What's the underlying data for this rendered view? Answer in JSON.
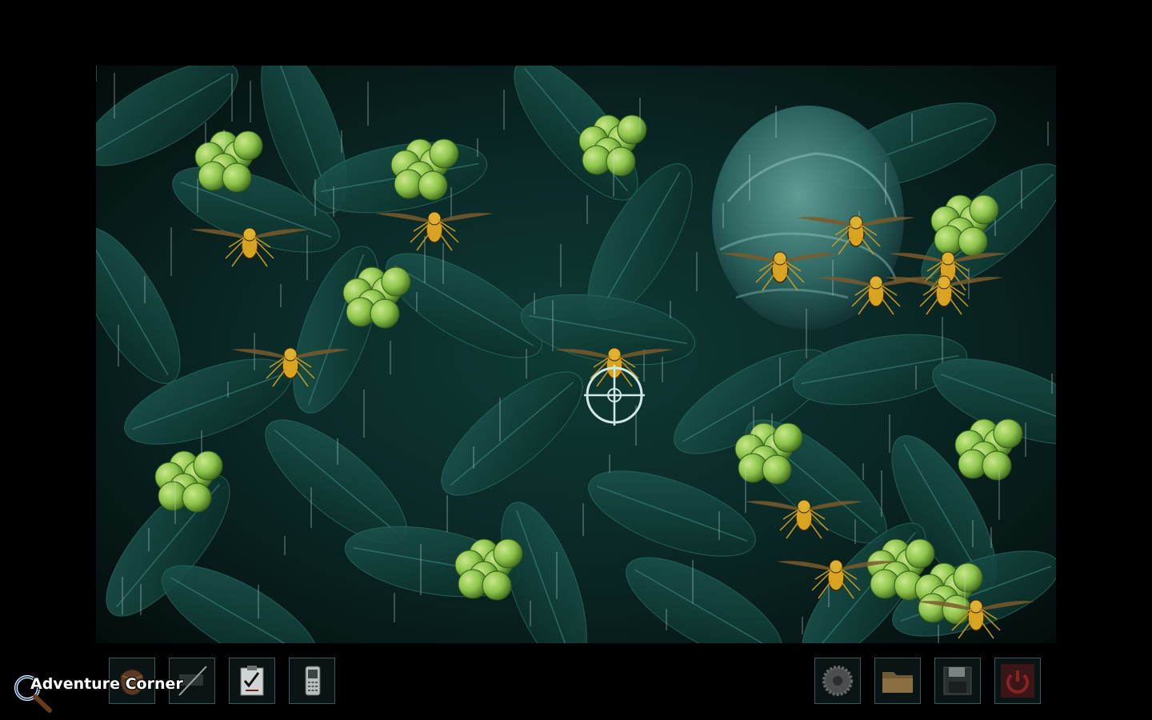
{
  "game": {
    "scene_name": "loquat-tree-with-wasps",
    "weather": "rain",
    "wasp_count": 13,
    "crosshair": "targeting-crosshair"
  },
  "inventory": {
    "items": [
      {
        "name": "leather-pouch",
        "icon": "pouch-icon"
      },
      {
        "name": "rod",
        "icon": "rod-icon"
      },
      {
        "name": "clipboard-checklist",
        "icon": "clipboard-icon"
      },
      {
        "name": "mobile-phone",
        "icon": "phone-icon"
      }
    ]
  },
  "menu": {
    "items": [
      {
        "name": "settings",
        "icon": "gear-icon"
      },
      {
        "name": "load",
        "icon": "folder-icon"
      },
      {
        "name": "save",
        "icon": "floppy-disk-icon"
      },
      {
        "name": "quit",
        "icon": "power-icon"
      }
    ]
  },
  "logo": {
    "text": "Adventure Corner",
    "icon": "magnifying-glass-icon"
  },
  "colors": {
    "background": "#000000",
    "foliage": "#0f3a34",
    "fruit": "#8cc34a",
    "wasp": "#d9a422",
    "crosshair": "#cfe8e8",
    "slot_border": "#3c5a5a"
  }
}
